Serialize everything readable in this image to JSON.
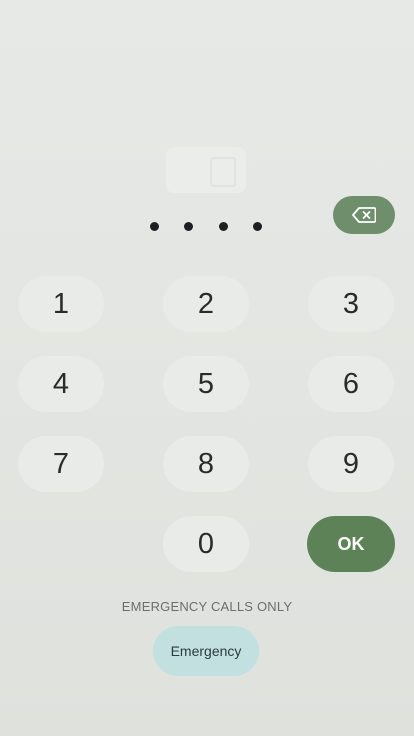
{
  "pin": {
    "entered_digits": 4,
    "dot_color": "#1e1f22"
  },
  "icons": {
    "sim": "sim-card-icon",
    "backspace": "backspace-icon"
  },
  "keypad": {
    "keys": [
      "1",
      "2",
      "3",
      "4",
      "5",
      "6",
      "7",
      "8",
      "9",
      "0"
    ],
    "ok_label": "OK",
    "accent_color": "#5e8257"
  },
  "emergency": {
    "notice": "EMERGENCY CALLS ONLY",
    "button_label": "Emergency",
    "button_color": "#c2e0e0"
  }
}
